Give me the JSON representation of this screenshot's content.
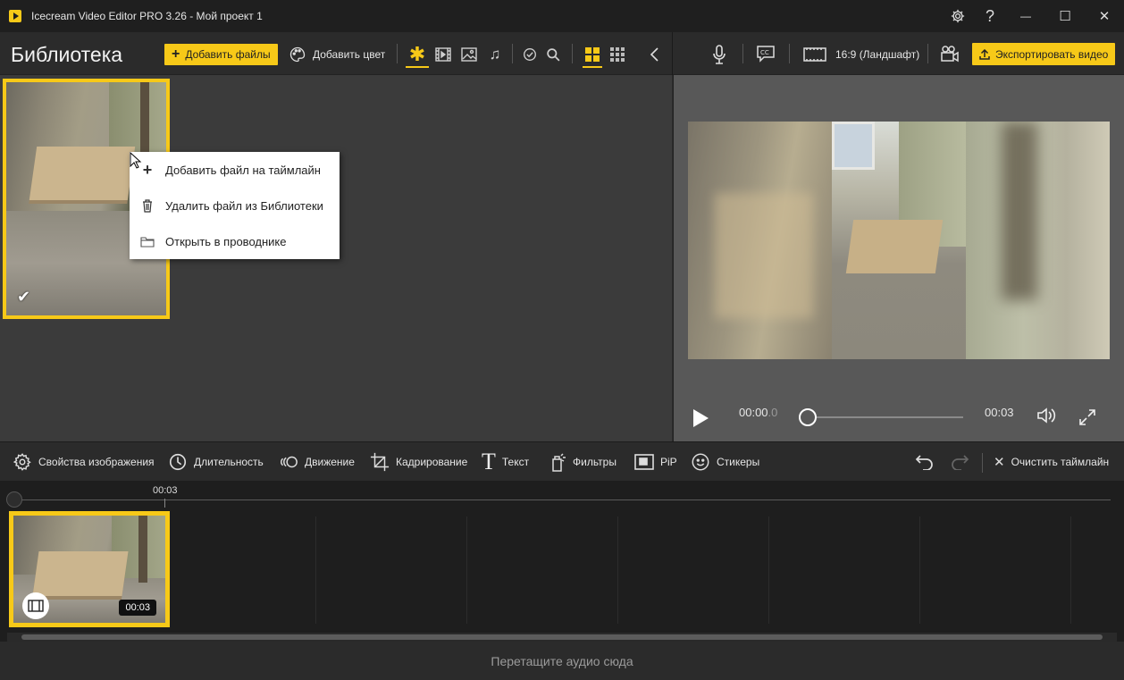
{
  "window": {
    "title": "Icecream Video Editor PRO 3.26  -  Мой проект 1",
    "minimize": "—",
    "maximize": "☐",
    "close": "✕",
    "help": "?"
  },
  "toolbar": {
    "library_title": "Библиотека",
    "add_files_label": "Добавить файлы",
    "add_color_label": "Добавить цвет",
    "aspect_label": "16:9 (Ландшафт)",
    "export_label": "Экспортировать видео"
  },
  "context_menu": {
    "items": [
      {
        "label": "Добавить файл на таймлайн",
        "icon": "plus-icon"
      },
      {
        "label": "Удалить файл из Библиотеки",
        "icon": "trash-icon"
      },
      {
        "label": "Открыть в проводнике",
        "icon": "folder-icon"
      }
    ]
  },
  "player": {
    "current_time": "00:00",
    "current_time_frac": ".0",
    "total_time": "00:03",
    "progress": 0
  },
  "edit_tools": [
    {
      "label": "Свойства изображения",
      "icon": "gear-icon"
    },
    {
      "label": "Длительность",
      "icon": "clock-icon"
    },
    {
      "label": "Движение",
      "icon": "motion-icon"
    },
    {
      "label": "Кадрирование",
      "icon": "crop-icon"
    },
    {
      "label": "Текст",
      "icon": "text-icon"
    },
    {
      "label": "Фильтры",
      "icon": "filter-icon"
    },
    {
      "label": "PiP",
      "icon": "pip-icon"
    },
    {
      "label": "Стикеры",
      "icon": "sticker-icon"
    }
  ],
  "timeline": {
    "clear_label": "Очистить таймлайн",
    "ruler_mark": "00:03",
    "clip_duration": "00:03",
    "audio_drop_hint": "Перетащите аудио сюда"
  },
  "colors": {
    "accent": "#f7c918",
    "background": "#2b2b2b",
    "timeline_bg": "#1e1e1e"
  }
}
